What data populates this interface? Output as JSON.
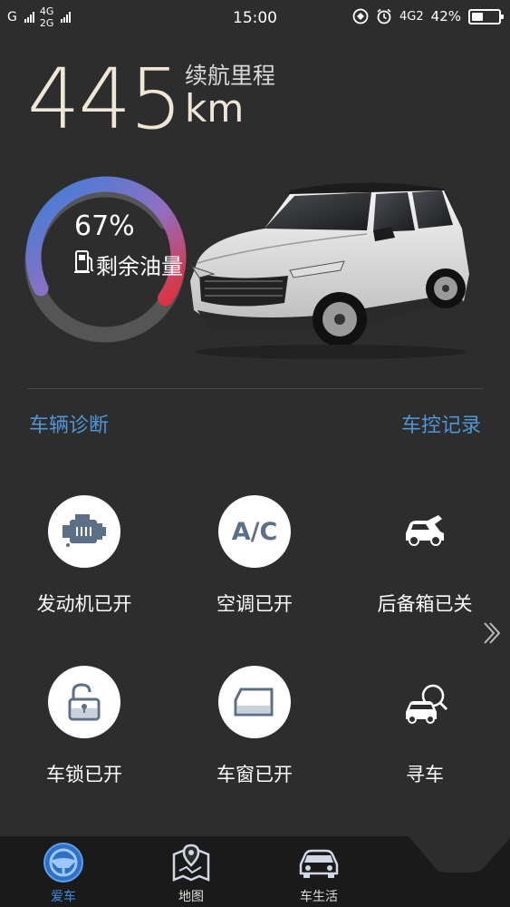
{
  "status_bar": {
    "sim1": "G",
    "net1": "4G",
    "net2": "2G",
    "time": "15:00",
    "net3": "4G2",
    "battery_percent": "42%",
    "battery_level": 0.42,
    "icons": [
      "signal-icon",
      "alarm-icon",
      "battery-icon"
    ]
  },
  "range": {
    "value": "445",
    "label": "续航里程",
    "unit": "km"
  },
  "fuel": {
    "percent": "67%",
    "label": "剩余油量",
    "level": 0.67,
    "gradient": [
      "#3a7fd8",
      "#8e6fc0",
      "#e0303a"
    ]
  },
  "links": {
    "diagnosis": "车辆诊断",
    "control_log": "车控记录"
  },
  "controls": [
    {
      "label": "发动机已开",
      "icon": "engine-icon"
    },
    {
      "label": "空调已开",
      "icon": "ac-icon",
      "icon_text": "A/C"
    },
    {
      "label": "后备箱已关",
      "icon": "trunk-icon"
    },
    {
      "label": "车锁已开",
      "icon": "lock-open-icon"
    },
    {
      "label": "车窗已开",
      "icon": "window-icon"
    },
    {
      "label": "寻车",
      "icon": "find-car-icon"
    }
  ],
  "tabs": [
    {
      "label": "爱车",
      "icon": "steering-wheel-icon",
      "active": true
    },
    {
      "label": "地图",
      "icon": "map-icon",
      "active": false
    },
    {
      "label": "车生活",
      "icon": "car-life-icon",
      "active": false
    }
  ],
  "colors": {
    "background": "#2d2d2d",
    "accent": "#4f96d6",
    "tab_active": "#3d8de0",
    "range_text": "#efe6d6"
  }
}
